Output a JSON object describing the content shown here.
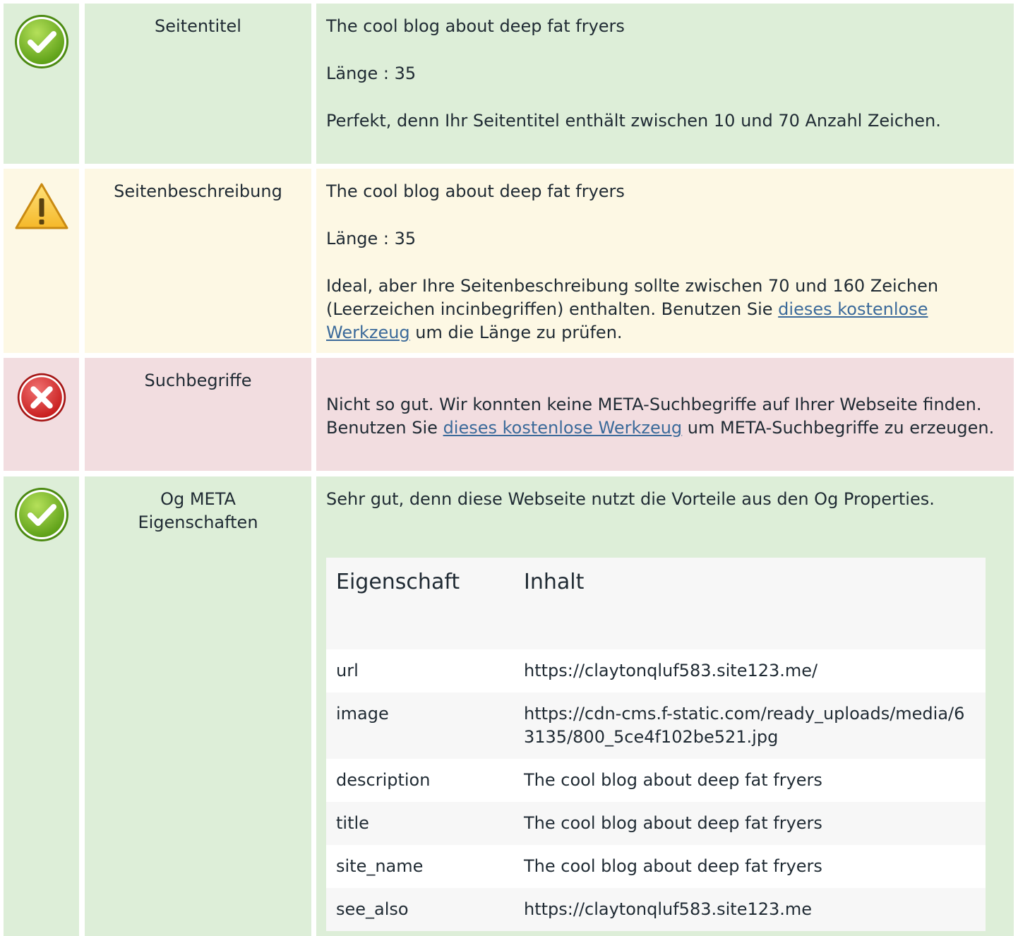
{
  "rows": {
    "title": {
      "status": "good",
      "label": "Seitentitel",
      "value": "The cool blog about deep fat fryers",
      "length": "Länge : 35",
      "message": "Perfekt, denn Ihr Seitentitel enthält zwischen 10 und 70 Anzahl Zeichen."
    },
    "description": {
      "status": "warning",
      "label": "Seitenbeschreibung",
      "value": "The cool blog about deep fat fryers",
      "length": "Länge : 35",
      "message_before": "Ideal, aber Ihre Seitenbeschreibung sollte zwischen 70 und 160 Zeichen (Leerzeichen incinbegriffen) enthalten. Benutzen Sie ",
      "link": "dieses kostenlose Werkzeug",
      "message_after": " um die Länge zu prüfen."
    },
    "keywords": {
      "status": "bad",
      "label": "Suchbegriffe",
      "message_before": "Nicht so gut. Wir konnten keine META-Suchbegriffe auf Ihrer Webseite finden. Benutzen Sie ",
      "link": "dieses kostenlose Werkzeug",
      "message_after": " um META-Suchbegriffe zu erzeugen."
    },
    "og": {
      "status": "good",
      "label": "Og META Eigenschaften",
      "message": "Sehr gut, denn diese Webseite nutzt die Vorteile aus den Og Properties.",
      "table": {
        "headers": [
          "Eigenschaft",
          "Inhalt"
        ],
        "rows": [
          {
            "property": "url",
            "content": "https://claytonqluf583.site123.me/"
          },
          {
            "property": "image",
            "content": "https://cdn-cms.f-static.com/ready_uploads/media/63135/800_5ce4f102be521.jpg"
          },
          {
            "property": "description",
            "content": "The cool blog about deep fat fryers"
          },
          {
            "property": "title",
            "content": "The cool blog about deep fat fryers"
          },
          {
            "property": "site_name",
            "content": "The cool blog about deep fat fryers"
          },
          {
            "property": "see_also",
            "content": "https://claytonqluf583.site123.me"
          }
        ]
      }
    }
  },
  "colors": {
    "good_bg": "#ddeed8",
    "warning_bg": "#fdf8e4",
    "bad_bg": "#f2dde0",
    "link": "#3b6a9a"
  },
  "icons": {
    "good": "check-circle-icon",
    "warning": "warning-triangle-icon",
    "bad": "x-circle-icon"
  }
}
